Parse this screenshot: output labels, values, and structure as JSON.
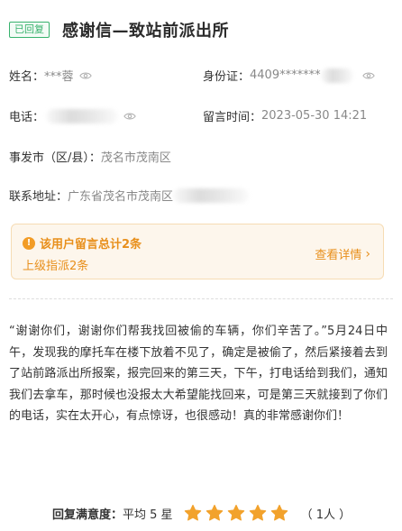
{
  "header": {
    "status_badge": "已回复",
    "title": "感谢信—致站前派出所"
  },
  "fields": {
    "name_label": "姓名：",
    "name_value": "***蓉",
    "id_label": "身份证：",
    "id_value": "4409*******",
    "phone_label": "电话：",
    "time_label": "留言时间：",
    "time_value": "2023-05-30 14:21",
    "district_label": "事发市（区/县）：",
    "district_value": "茂名市茂南区",
    "address_label": "联系地址：",
    "address_value": "广东省茂名市茂南区"
  },
  "notice": {
    "icon": "!",
    "total_text": "该用户留言总计2条",
    "assigned_text": "上级指派2条",
    "link_text": "查看详情",
    "link_chevron": "›"
  },
  "message": {
    "text": "“谢谢你们，谢谢你们帮我找回被偷的车辆，你们辛苦了。”5月24日中午，发现我的摩托车在楼下放着不见了，确定是被偷了，然后紧接着去到了站前路派出所报案，报完回来的第三天，下午，打电话给到我们，通知我们去拿车，那时候也没报太大希望能找回来，可是第三天就接到了你们的电话，实在太开心，有点惊讶，也很感动！真的非常感谢你们！"
  },
  "rating": {
    "label": "回复满意度：",
    "average_text": "平均 5  星",
    "stars": 5,
    "max_stars": 5,
    "count_text": "（ 1人 ）"
  },
  "colors": {
    "accent_green": "#38b26d",
    "warning_orange": "#e88f1b",
    "star_orange": "#f2a22c",
    "notice_bg": "#fdf6ec"
  },
  "icons": [
    "eye-icon",
    "info-icon",
    "chevron-right-icon",
    "star-icon"
  ]
}
